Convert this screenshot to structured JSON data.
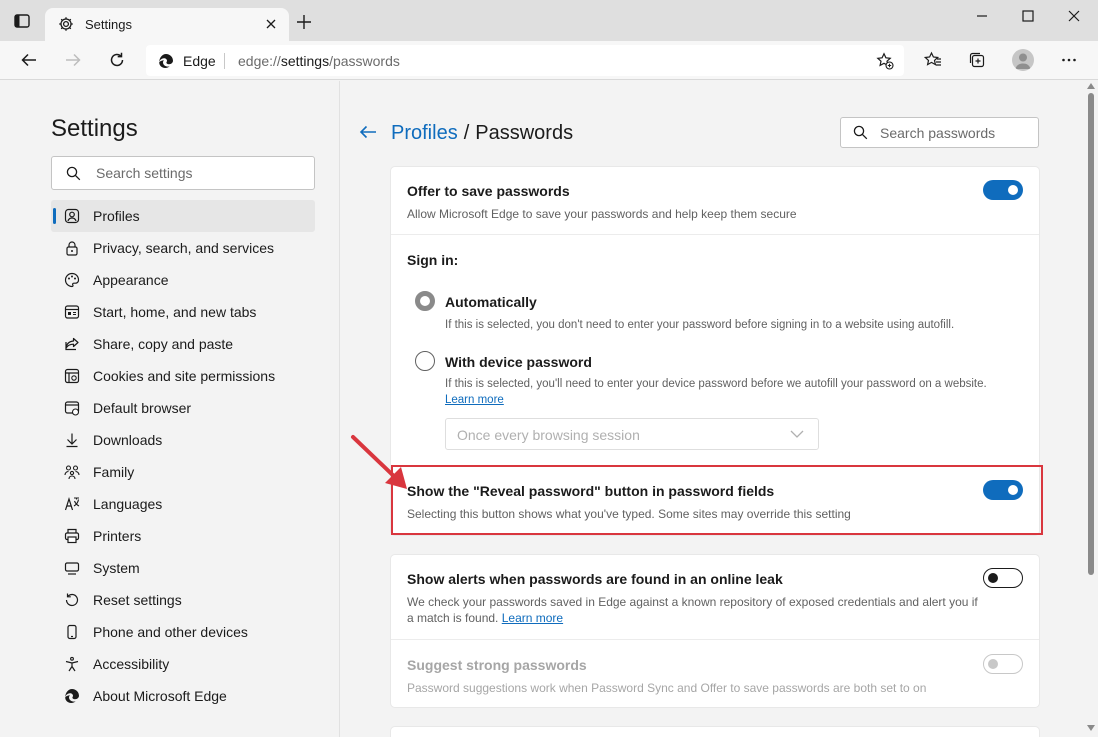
{
  "tab": {
    "title": "Settings"
  },
  "omnibox": {
    "site_label": "Edge",
    "url_prefix": "edge://",
    "url_host": "settings",
    "url_path": "/passwords"
  },
  "sidebar": {
    "title": "Settings",
    "search_placeholder": "Search settings",
    "items": [
      {
        "label": "Profiles",
        "icon": "profile-icon",
        "active": true
      },
      {
        "label": "Privacy, search, and services",
        "icon": "lock-icon"
      },
      {
        "label": "Appearance",
        "icon": "palette-icon"
      },
      {
        "label": "Start, home, and new tabs",
        "icon": "home-tabs-icon"
      },
      {
        "label": "Share, copy and paste",
        "icon": "share-icon"
      },
      {
        "label": "Cookies and site permissions",
        "icon": "cookies-icon"
      },
      {
        "label": "Default browser",
        "icon": "browser-icon"
      },
      {
        "label": "Downloads",
        "icon": "download-icon"
      },
      {
        "label": "Family",
        "icon": "family-icon"
      },
      {
        "label": "Languages",
        "icon": "languages-icon"
      },
      {
        "label": "Printers",
        "icon": "printer-icon"
      },
      {
        "label": "System",
        "icon": "system-icon"
      },
      {
        "label": "Reset settings",
        "icon": "reset-icon"
      },
      {
        "label": "Phone and other devices",
        "icon": "phone-icon"
      },
      {
        "label": "Accessibility",
        "icon": "accessibility-icon"
      },
      {
        "label": "About Microsoft Edge",
        "icon": "edge-icon"
      }
    ]
  },
  "main": {
    "breadcrumb_parent": "Profiles",
    "breadcrumb_sep": "/",
    "breadcrumb_current": "Passwords",
    "search_placeholder": "Search passwords",
    "offer": {
      "title": "Offer to save passwords",
      "desc": "Allow Microsoft Edge to save your passwords and help keep them secure",
      "enabled": true
    },
    "signin": {
      "label": "Sign in:",
      "auto_title": "Automatically",
      "auto_desc": "If this is selected, you don't need to enter your password before signing in to a website using autofill.",
      "device_title": "With device password",
      "device_desc": "If this is selected, you'll need to enter your device password before we autofill your password on a website.",
      "learn_more": "Learn more",
      "dropdown_value": "Once every browsing session"
    },
    "reveal": {
      "title": "Show the \"Reveal password\" button in password fields",
      "desc": "Selecting this button shows what you've typed. Some sites may override this setting",
      "enabled": true
    },
    "alerts": {
      "title": "Show alerts when passwords are found in an online leak",
      "desc_line1": "We check your passwords saved in Edge against a known repository of exposed credentials and alert you if",
      "desc_line2": "a match is found.",
      "learn_more": "Learn more",
      "enabled": false
    },
    "suggest": {
      "title": "Suggest strong passwords",
      "desc": "Password suggestions work when Password Sync and Offer to save passwords are both set to on",
      "enabled": false
    }
  },
  "colors": {
    "accent": "#0f6cbd",
    "highlight": "#d9363e"
  }
}
